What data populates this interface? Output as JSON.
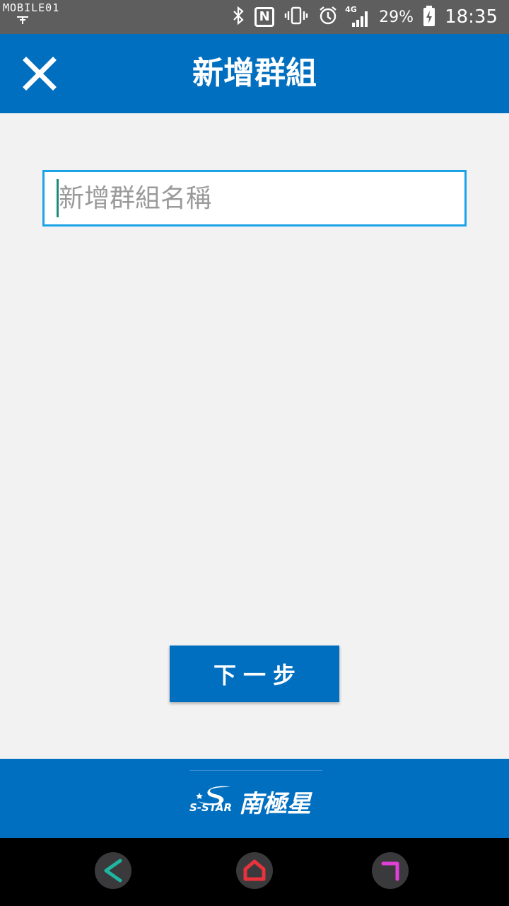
{
  "status_bar": {
    "watermark": "MOBILE01",
    "network": "4G",
    "battery_percent": "29%",
    "time": "18:35",
    "icons": [
      "usb-debug-icon",
      "bluetooth-icon",
      "nfc-icon",
      "vibrate-icon",
      "alarm-icon",
      "signal-icon",
      "battery-charging-icon"
    ]
  },
  "app_bar": {
    "title": "新增群組",
    "close_icon": "close-icon"
  },
  "form": {
    "group_name_placeholder": "新增群組名稱",
    "group_name_value": ""
  },
  "actions": {
    "next_label": "下一步"
  },
  "footer": {
    "brand_en": "S-STAR",
    "brand_zh": "南極星"
  },
  "nav_bar": {
    "buttons": [
      "back-icon",
      "home-icon",
      "recents-icon"
    ]
  },
  "colors": {
    "primary": "#006fc0",
    "background": "#f2f2f3",
    "input_border": "#1aa3e8",
    "status_bar": "#5e5e5e",
    "nav_back": "#1fb5a0",
    "nav_home": "#e8323c",
    "nav_recents": "#e040d8"
  }
}
